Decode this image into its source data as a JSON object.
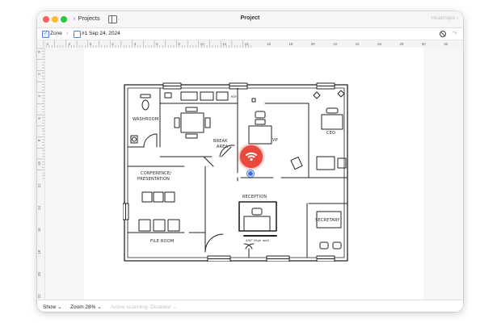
{
  "window": {
    "title": "Project",
    "back_label": "Projects",
    "right_link": "Heatmaps",
    "right_chevron": "›",
    "back_chevron": "‹"
  },
  "toolbar": {
    "zone_label": "Zone",
    "separator": "›",
    "item_label": "#1 Sep 24, 2024",
    "redo_glyph": "↷"
  },
  "ruler": {
    "horizontal": [
      "-4",
      "-2",
      "0",
      "2",
      "4",
      "6",
      "8",
      "10",
      "12",
      "14",
      "16",
      "18",
      "20",
      "22",
      "24",
      "26",
      "28",
      "30",
      "32"
    ],
    "vertical": [
      "0",
      "2",
      "4",
      "6",
      "8",
      "10",
      "12",
      "14",
      "16",
      "18",
      "20",
      "22"
    ]
  },
  "floor_plan": {
    "rooms": [
      {
        "id": "washroom",
        "label": "WASHROOM"
      },
      {
        "id": "break",
        "label_line1": "BREAK",
        "label_line2": "AREA"
      },
      {
        "id": "vp",
        "label": "VP"
      },
      {
        "id": "ceo",
        "label": "CEO"
      },
      {
        "id": "conference",
        "label_line1": "CONFERENCE/",
        "label_line2": "PRESENTATION"
      },
      {
        "id": "reception",
        "label": "RECEPTION"
      },
      {
        "id": "secretary",
        "label": "SECRETARY"
      },
      {
        "id": "file",
        "label": "FILE ROOM"
      }
    ],
    "note": "4/6\" High wall",
    "fridge_label": "REF"
  },
  "status": {
    "show_label": "Show",
    "zoom_label": "Zoom 28%",
    "scanning_label": "Active scanning: Disabled",
    "chevron": "⌄"
  },
  "colors": {
    "pin": "#e8493c",
    "pin_dot": "#3a6fe2",
    "accent": "#4a7fd6"
  },
  "icons": {
    "access_point": "wifi-icon",
    "hide": "no-entry-icon",
    "sidebar": "sidebar-icon"
  }
}
